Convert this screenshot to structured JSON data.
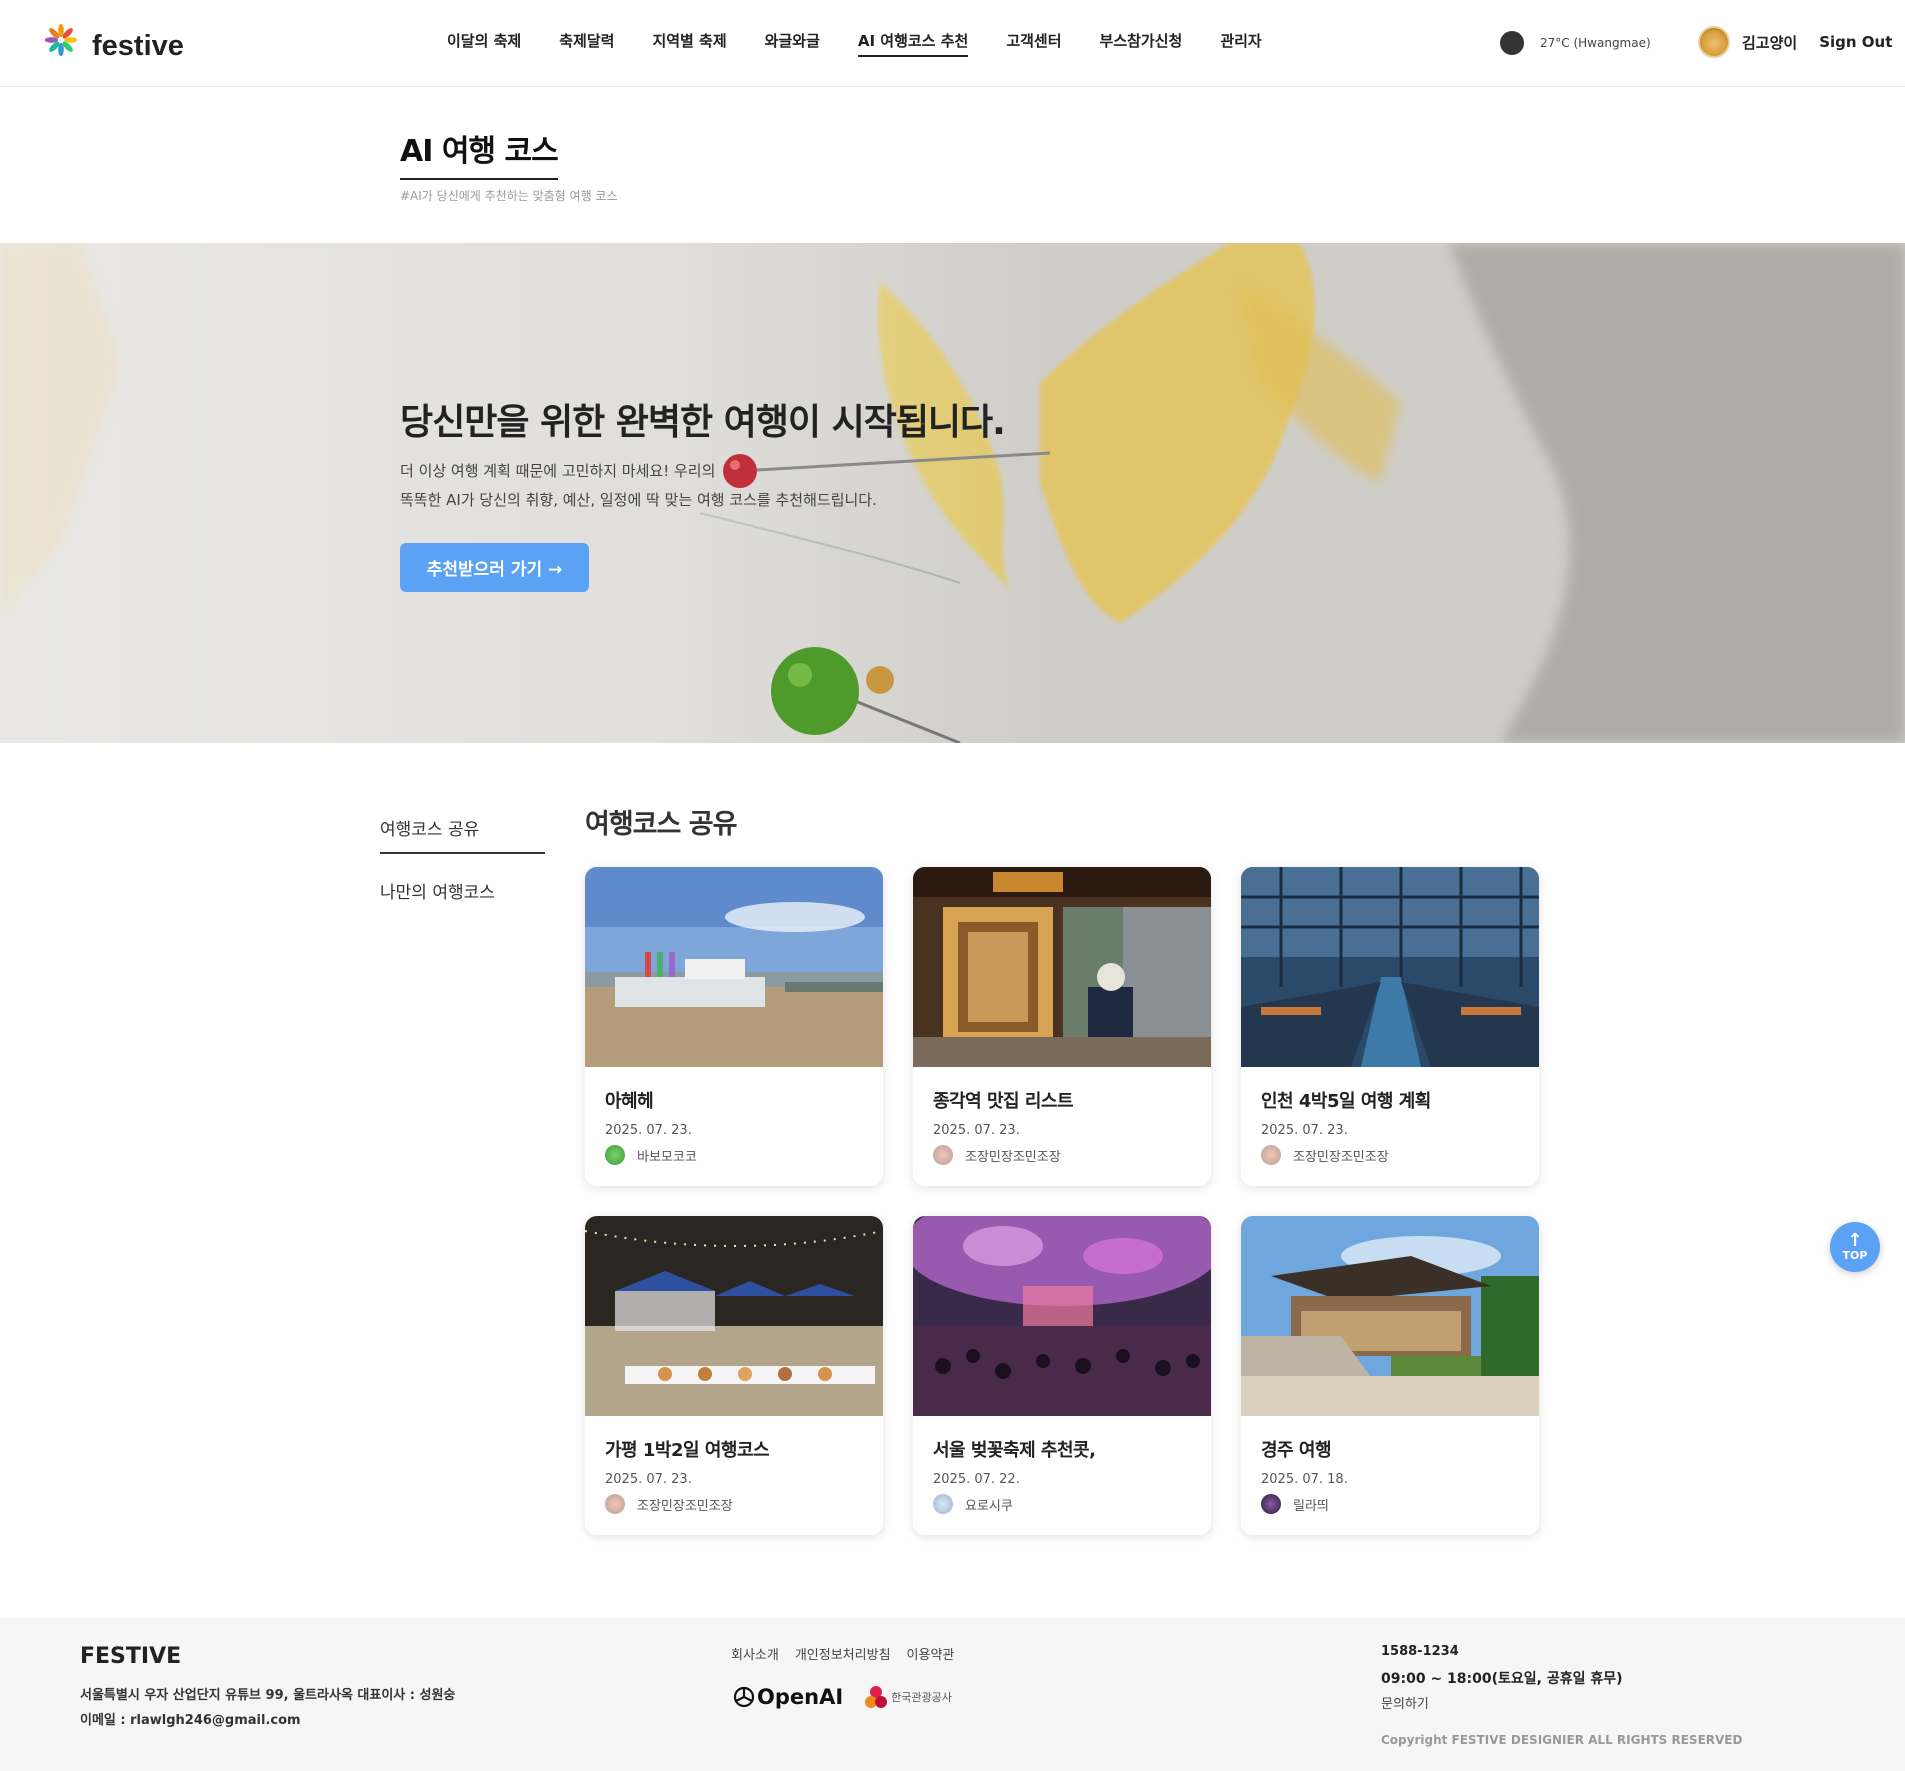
{
  "header": {
    "logo_text": "festive",
    "nav": [
      "이달의 축제",
      "축제달력",
      "지역별 축제",
      "와글와글",
      "AI 여행코스 추천",
      "고객센터",
      "부스참가신청",
      "관리자"
    ],
    "active_nav": "AI 여행코스 추천",
    "weather": "27°C (Hwangmae)",
    "user_name": "김고양이",
    "signout": "Sign Out"
  },
  "page": {
    "title": "AI 여행 코스",
    "subtitle": "#AI가 당신에게 추천하는 맞춤형 여행 코스"
  },
  "hero": {
    "title": "당신만을 위한 완벽한 여행이 시작됩니다.",
    "desc_line1": "더 이상 여행 계획 때문에 고민하지 마세요! 우리의",
    "desc_line2": "똑똑한 AI가 당신의 취향, 예산, 일정에 딱 맞는 여행 코스를 추천해드립니다.",
    "button": "추천받으러 가기 →"
  },
  "sidebar": {
    "items": [
      "여행코스 공유",
      "나만의 여행코스"
    ]
  },
  "section_title": "여행코스 공유",
  "cards": [
    {
      "title": "아혜헤",
      "date": "2025. 07. 23.",
      "author": "바보모코코"
    },
    {
      "title": "종각역 맛집 리스트",
      "date": "2025. 07. 23.",
      "author": "조장민장조민조장"
    },
    {
      "title": "인천 4박5일 여행 계획",
      "date": "2025. 07. 23.",
      "author": "조장민장조민조장"
    },
    {
      "title": "가평 1박2일 여행코스",
      "date": "2025. 07. 23.",
      "author": "조장민장조민조장"
    },
    {
      "title": "서울 벚꽃축제 추천콧,",
      "date": "2025. 07. 22.",
      "author": "요로시쿠"
    },
    {
      "title": "경주 여행",
      "date": "2025. 07. 18.",
      "author": "릴라띄"
    }
  ],
  "top_button": "TOP",
  "footer": {
    "brand": "FESTIVE",
    "address": "서울특별시 우자 산업단지 유튜브 99, 울트라사옥 대표이사 : 성원숭",
    "email": "이메일 : rlawlgh246@gmail.com",
    "links": [
      "회사소개",
      "개인정보처리방침",
      "이용약관"
    ],
    "openai": "OpenAI",
    "kto": "한국관광공사",
    "phone": "1588-1234",
    "hours": "09:00 ~ 18:00(토요일, 공휴일 휴무)",
    "ask": "문의하기",
    "copyright": "Copyright FESTIVE DESIGNIER ALL RIGHTS RESERVED"
  }
}
